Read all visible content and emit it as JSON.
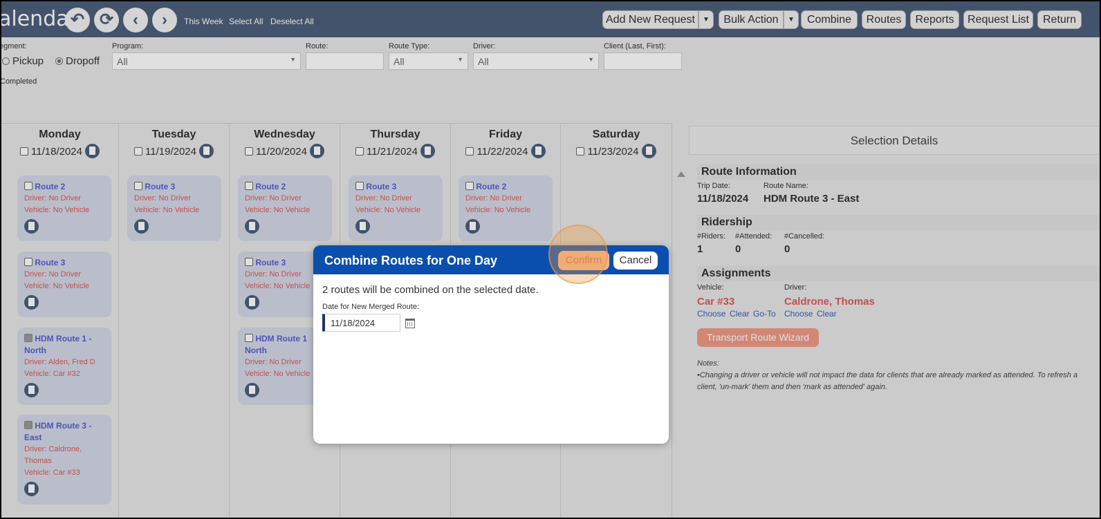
{
  "header": {
    "title": "alendar",
    "links": [
      "This Week",
      "Select All",
      "Deselect All"
    ],
    "buttons": {
      "add_new_request": "Add New Request",
      "bulk_action": "Bulk Action",
      "combine": "Combine",
      "routes": "Routes",
      "reports": "Reports",
      "request_list": "Request List",
      "return": "Return"
    }
  },
  "filters": {
    "segment_label": "egment:",
    "pickup": "Pickup",
    "dropoff": "Dropoff",
    "completed": "Completed",
    "program_label": "Program:",
    "program_value": "All",
    "route_label": "Route:",
    "route_value": "",
    "route_type_label": "Route Type:",
    "route_type_value": "All",
    "driver_label": "Driver:",
    "driver_value": "All",
    "client_label": "Client (Last, First):",
    "client_value": ""
  },
  "days": [
    {
      "name": "Monday",
      "date": "11/18/2024"
    },
    {
      "name": "Tuesday",
      "date": "11/19/2024"
    },
    {
      "name": "Wednesday",
      "date": "11/20/2024"
    },
    {
      "name": "Thursday",
      "date": "11/21/2024"
    },
    {
      "name": "Friday",
      "date": "11/22/2024"
    },
    {
      "name": "Saturday",
      "date": "11/23/2024"
    }
  ],
  "cards": {
    "mon1": {
      "name": "Route 2",
      "driver": "Driver: No Driver",
      "vehicle": "Vehicle: No Vehicle"
    },
    "mon2": {
      "name": "Route 3",
      "driver": "Driver: No Driver",
      "vehicle": "Vehicle: No Vehicle"
    },
    "mon3": {
      "name1": "HDM Route 1 -",
      "name2": "North",
      "driver": "Driver: Alden, Fred D",
      "vehicle": "Vehicle: Car #32"
    },
    "mon4": {
      "name1": "HDM Route 3 -",
      "name2": "East",
      "driver1": "Driver: Caldrone,",
      "driver2": "Thomas",
      "vehicle": "Vehicle: Car #33"
    },
    "tue1": {
      "name": "Route 3",
      "driver": "Driver: No Driver",
      "vehicle": "Vehicle: No Vehicle"
    },
    "wed1": {
      "name": "Route 2",
      "driver": "Driver: No Driver",
      "vehicle": "Vehicle: No Vehicle"
    },
    "wed2": {
      "name": "Route 3",
      "driver": "Driver: No Driver",
      "vehicle": "Vehicle: No Vehicle"
    },
    "wed3": {
      "name1": "HDM Route 1",
      "name2": "North",
      "driver": "Driver: No Driver",
      "vehicle": "Vehicle: No Vehicle"
    },
    "thu1": {
      "name": "Route 3",
      "driver": "Driver: No Driver",
      "vehicle": "Vehicle: No Vehicle"
    },
    "fri1": {
      "name": "Route 2",
      "driver": "Driver: No Driver",
      "vehicle": "Vehicle: No Vehicle"
    }
  },
  "details": {
    "header": "Selection Details",
    "route_info": "Route Information",
    "trip_date_label": "Trip Date:",
    "trip_date": "11/18/2024",
    "route_name_label": "Route Name:",
    "route_name": "HDM Route 3 - East",
    "ridership": "Ridership",
    "riders_label": "#Riders:",
    "riders": "1",
    "attended_label": "#Attended:",
    "attended": "0",
    "cancelled_label": "#Cancelled:",
    "cancelled": "0",
    "assignments": "Assignments",
    "vehicle_label": "Vehicle:",
    "vehicle": "Car #33",
    "driver_label": "Driver:",
    "driver": "Caldrone, Thomas",
    "vehicle_links": [
      "Choose",
      "Clear",
      "Go-To"
    ],
    "driver_links": [
      "Choose",
      "Clear"
    ],
    "wizard": "Transport Route Wizard",
    "notes_label": "Notes:",
    "notes": "•Changing a driver or vehicle will not impact the data for clients that are already marked as attended. To refresh a client, 'un-mark' them and then 'mark as attended' again."
  },
  "modal": {
    "title": "Combine Routes for One Day",
    "confirm": "Confirm",
    "cancel": "Cancel",
    "message": "2 routes will be combined on the selected date.",
    "date_label": "Date for New Merged Route:",
    "date_value": "11/18/2024"
  },
  "colors": {
    "topbar": "#4d5f7c",
    "modal_header": "#0b4fae",
    "route_link": "#5a5fcf",
    "warning_red": "#e05a5a"
  }
}
